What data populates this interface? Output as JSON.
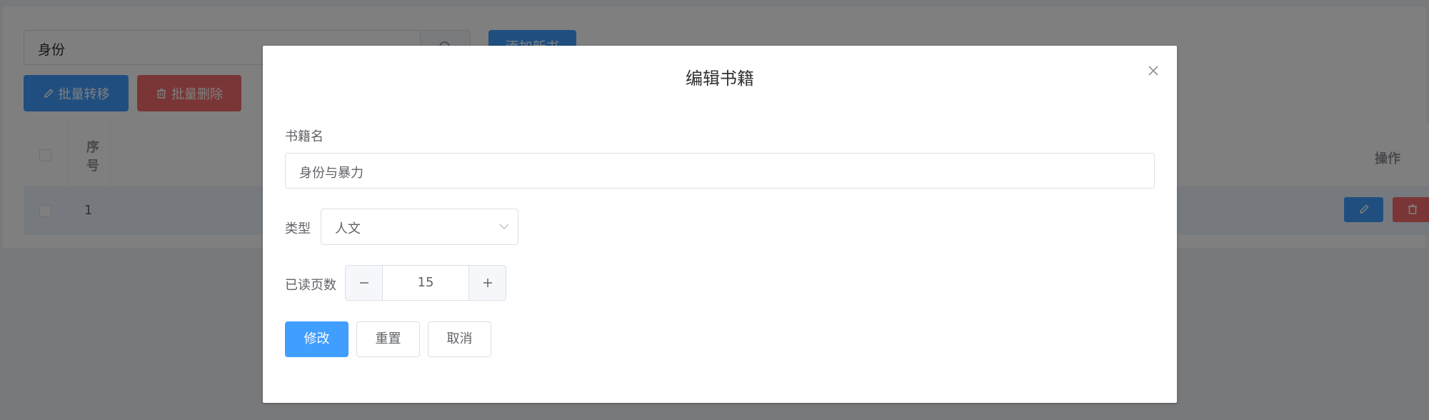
{
  "toolbar": {
    "search_value": "身份",
    "add_book_label": "添加新书",
    "batch_move_label": "批量转移",
    "batch_delete_label": "批量删除"
  },
  "table": {
    "header_index": "序号",
    "header_ops": "操作",
    "rows": [
      {
        "index": "1"
      }
    ]
  },
  "dialog": {
    "title": "编辑书籍",
    "name_label": "书籍名",
    "name_value": "身份与暴力",
    "type_label": "类型",
    "type_value": "人文",
    "pages_label": "已读页数",
    "pages_value": "15",
    "submit_label": "修改",
    "reset_label": "重置",
    "cancel_label": "取消"
  },
  "colors": {
    "primary": "#409eff",
    "danger": "#f56c6c"
  }
}
